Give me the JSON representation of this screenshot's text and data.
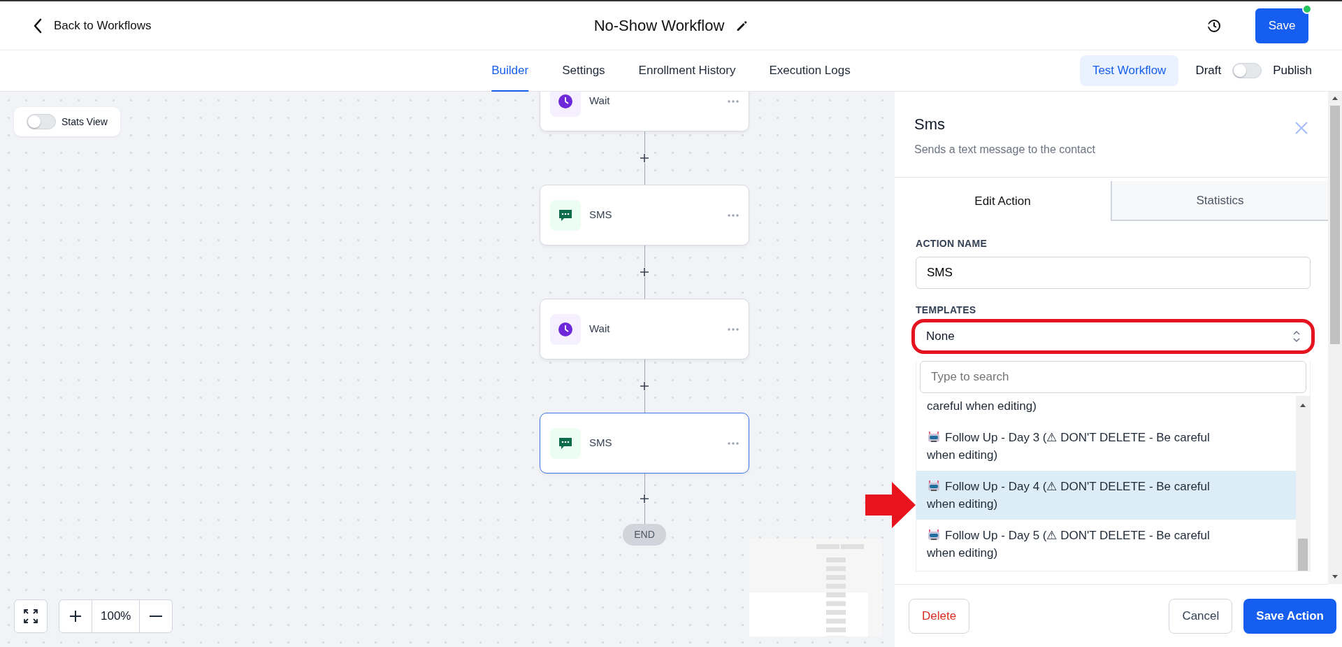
{
  "header": {
    "back_label": "Back to Workflows",
    "title": "No-Show Workflow",
    "save_label": "Save"
  },
  "nav_tabs": [
    {
      "label": "Builder",
      "selected": true
    },
    {
      "label": "Settings",
      "selected": false
    },
    {
      "label": "Enrollment History",
      "selected": false
    },
    {
      "label": "Execution Logs",
      "selected": false
    }
  ],
  "test_button": "Test Workflow",
  "publish_toggle": {
    "off_label": "Draft",
    "on_label": "Publish",
    "on": false
  },
  "canvas": {
    "stats_toggle": {
      "label": "Stats View",
      "on": false
    },
    "nodes": [
      {
        "kind": "wait",
        "label": "Wait",
        "selected": false
      },
      {
        "kind": "sms",
        "label": "SMS",
        "selected": false
      },
      {
        "kind": "wait",
        "label": "Wait",
        "selected": false
      },
      {
        "kind": "sms",
        "label": "SMS",
        "selected": true
      }
    ],
    "end_label": "END",
    "zoom_label": "100%"
  },
  "panel": {
    "title": "Sms",
    "subtitle": "Sends a text message to the contact",
    "tabs": [
      {
        "label": "Edit Action",
        "selected": true
      },
      {
        "label": "Statistics",
        "selected": false
      }
    ],
    "action_name_label": "ACTION NAME",
    "action_name_value": "SMS",
    "templates_label": "TEMPLATES",
    "template_value": "None",
    "search_placeholder": "Type to search",
    "options": [
      {
        "kind": "continuation",
        "label": "careful when editing)",
        "selected": false
      },
      {
        "kind": "template",
        "label": "Follow Up - Day 3 (⚠ DON'T DELETE - Be careful when editing)",
        "selected": false
      },
      {
        "kind": "template",
        "label": "Follow Up - Day 4 (⚠ DON'T DELETE - Be careful when editing)",
        "selected": true
      },
      {
        "kind": "template",
        "label": "Follow Up - Day 5 (⚠ DON'T DELETE - Be careful when editing)",
        "selected": false
      }
    ],
    "delete_label": "Delete",
    "cancel_label": "Cancel",
    "save_label": "Save Action"
  }
}
